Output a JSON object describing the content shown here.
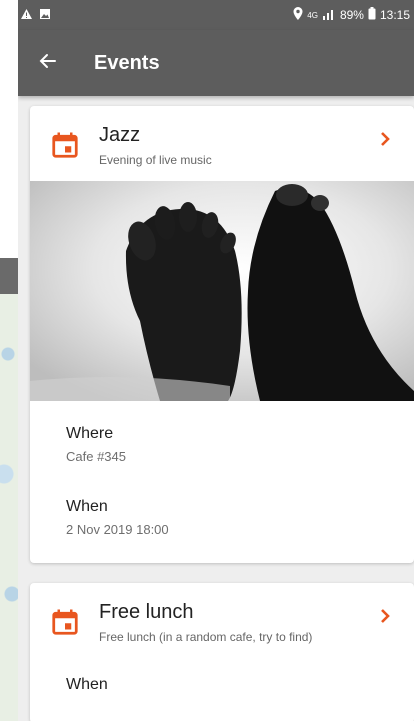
{
  "status_bar": {
    "left_icons": [
      "download-icon",
      "alert-icon",
      "image-icon"
    ],
    "network": "4G",
    "battery": "89%",
    "time": "13:15"
  },
  "toolbar": {
    "title": "Events",
    "back_icon": "arrow-left-icon"
  },
  "colors": {
    "bar": "#5d5d5d",
    "accent": "#e8561f"
  },
  "events": [
    {
      "title": "Jazz",
      "subtitle": "Evening of live music",
      "has_image": true,
      "where_label": "Where",
      "where_value": "Cafe #345",
      "when_label": "When",
      "when_value": "2 Nov 2019 18:00"
    },
    {
      "title": "Free lunch",
      "subtitle": "Free lunch (in a random cafe, try to find)",
      "when_label": "When"
    }
  ]
}
